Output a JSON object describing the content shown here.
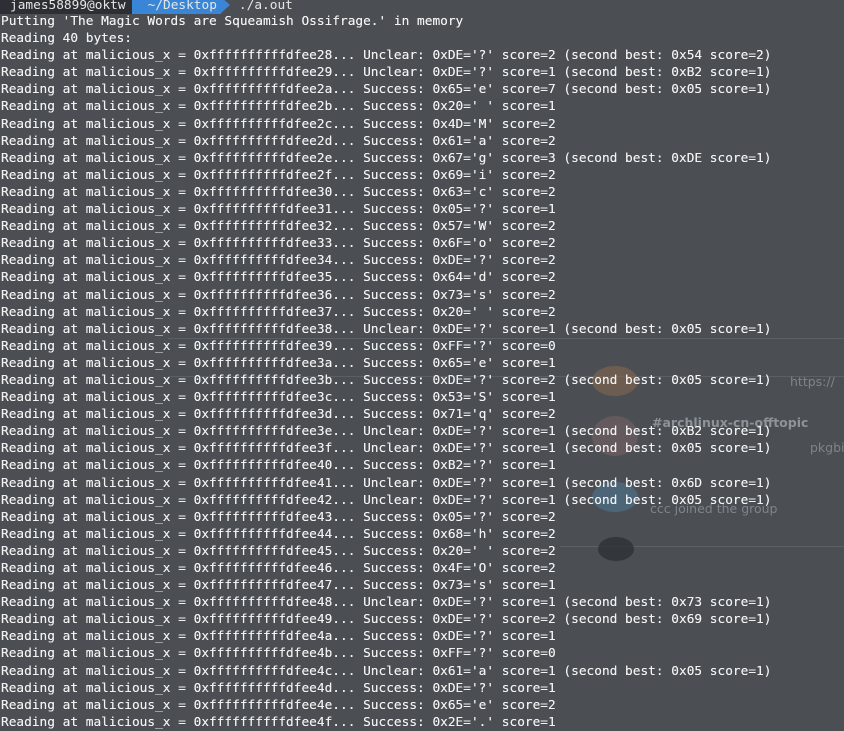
{
  "terminal": {
    "prompt": {
      "user_host": "james58899@oktw",
      "directory": "~/Desktop",
      "command": "./a.out"
    },
    "lines": [
      "Putting 'The Magic Words are Squeamish Ossifrage.' in memory",
      "Reading 40 bytes:",
      "Reading at malicious_x = 0xffffffffffdfee28... Unclear: 0xDE='?' score=2 (second best: 0x54 score=2)",
      "Reading at malicious_x = 0xffffffffffdfee29... Unclear: 0xDE='?' score=1 (second best: 0xB2 score=1)",
      "Reading at malicious_x = 0xffffffffffdfee2a... Success: 0x65='e' score=7 (second best: 0x05 score=1)",
      "Reading at malicious_x = 0xffffffffffdfee2b... Success: 0x20=' ' score=1",
      "Reading at malicious_x = 0xffffffffffdfee2c... Success: 0x4D='M' score=2",
      "Reading at malicious_x = 0xffffffffffdfee2d... Success: 0x61='a' score=2",
      "Reading at malicious_x = 0xffffffffffdfee2e... Success: 0x67='g' score=3 (second best: 0xDE score=1)",
      "Reading at malicious_x = 0xffffffffffdfee2f... Success: 0x69='i' score=2",
      "Reading at malicious_x = 0xffffffffffdfee30... Success: 0x63='c' score=2",
      "Reading at malicious_x = 0xffffffffffdfee31... Success: 0x05='?' score=1",
      "Reading at malicious_x = 0xffffffffffdfee32... Success: 0x57='W' score=2",
      "Reading at malicious_x = 0xffffffffffdfee33... Success: 0x6F='o' score=2",
      "Reading at malicious_x = 0xffffffffffdfee34... Success: 0xDE='?' score=2",
      "Reading at malicious_x = 0xffffffffffdfee35... Success: 0x64='d' score=2",
      "Reading at malicious_x = 0xffffffffffdfee36... Success: 0x73='s' score=2",
      "Reading at malicious_x = 0xffffffffffdfee37... Success: 0x20=' ' score=2",
      "Reading at malicious_x = 0xffffffffffdfee38... Unclear: 0xDE='?' score=1 (second best: 0x05 score=1)",
      "Reading at malicious_x = 0xffffffffffdfee39... Success: 0xFF='?' score=0",
      "Reading at malicious_x = 0xffffffffffdfee3a... Success: 0x65='e' score=1",
      "Reading at malicious_x = 0xffffffffffdfee3b... Success: 0xDE='?' score=2 (second best: 0x05 score=1)",
      "Reading at malicious_x = 0xffffffffffdfee3c... Success: 0x53='S' score=1",
      "Reading at malicious_x = 0xffffffffffdfee3d... Success: 0x71='q' score=2",
      "Reading at malicious_x = 0xffffffffffdfee3e... Unclear: 0xDE='?' score=1 (second best: 0xB2 score=1)",
      "Reading at malicious_x = 0xffffffffffdfee3f... Unclear: 0xDE='?' score=1 (second best: 0x05 score=1)",
      "Reading at malicious_x = 0xffffffffffdfee40... Success: 0xB2='?' score=1",
      "Reading at malicious_x = 0xffffffffffdfee41... Unclear: 0xDE='?' score=1 (second best: 0x6D score=1)",
      "Reading at malicious_x = 0xffffffffffdfee42... Unclear: 0xDE='?' score=1 (second best: 0x05 score=1)",
      "Reading at malicious_x = 0xffffffffffdfee43... Success: 0x05='?' score=2",
      "Reading at malicious_x = 0xffffffffffdfee44... Success: 0x68='h' score=2",
      "Reading at malicious_x = 0xffffffffffdfee45... Success: 0x20=' ' score=2",
      "Reading at malicious_x = 0xffffffffffdfee46... Success: 0x4F='O' score=2",
      "Reading at malicious_x = 0xffffffffffdfee47... Success: 0x73='s' score=1",
      "Reading at malicious_x = 0xffffffffffdfee48... Unclear: 0xDE='?' score=1 (second best: 0x73 score=1)",
      "Reading at malicious_x = 0xffffffffffdfee49... Success: 0xDE='?' score=2 (second best: 0x69 score=1)",
      "Reading at malicious_x = 0xffffffffffdfee4a... Success: 0xDE='?' score=1",
      "Reading at malicious_x = 0xffffffffffdfee4b... Success: 0xFF='?' score=0",
      "Reading at malicious_x = 0xffffffffffdfee4c... Unclear: 0x61='a' score=1 (second best: 0x05 score=1)",
      "Reading at malicious_x = 0xffffffffffdfee4d... Success: 0xDE='?' score=1",
      "Reading at malicious_x = 0xffffffffffdfee4e... Success: 0x65='e' score=2",
      "Reading at malicious_x = 0xffffffffffdfee4f... Success: 0x2E='.' score=1"
    ]
  },
  "background_window": {
    "channel_name": "#archlinux-cn-offtopic",
    "preview_text": "pkgbi",
    "link_fragment": "https://",
    "group_event": "ccc joined the group"
  },
  "colors": {
    "terminal_bg": "#4b4f54",
    "text": "#f2f2f2",
    "prompt_user_bg": "#2c2f33",
    "prompt_dir_bg": "#3a86d6"
  }
}
